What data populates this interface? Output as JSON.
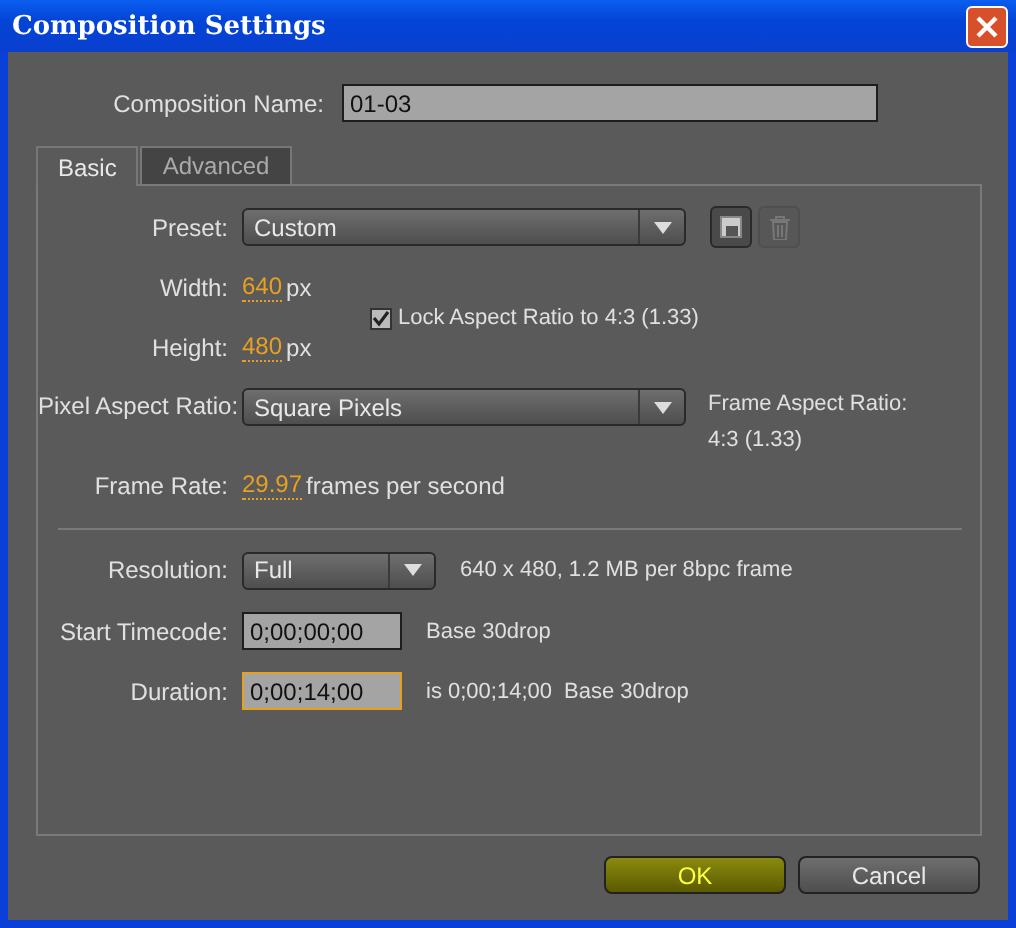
{
  "window": {
    "title": "Composition Settings"
  },
  "composition_name": {
    "label": "Composition Name:",
    "value": "01-03"
  },
  "tabs": [
    {
      "label": "Basic",
      "selected": true
    },
    {
      "label": "Advanced",
      "selected": false
    }
  ],
  "preset": {
    "label": "Preset:",
    "value": "Custom"
  },
  "width": {
    "label": "Width:",
    "value": "640",
    "unit": "px"
  },
  "lock_aspect": {
    "label": "Lock Aspect Ratio to 4:3 (1.33)",
    "checked": true
  },
  "height": {
    "label": "Height:",
    "value": "480",
    "unit": "px"
  },
  "pixel_aspect": {
    "label": "Pixel Aspect Ratio:",
    "value": "Square Pixels"
  },
  "frame_aspect": {
    "label": "Frame Aspect Ratio:",
    "value": "4:3 (1.33)"
  },
  "frame_rate": {
    "label": "Frame Rate:",
    "value": "29.97",
    "unit": "frames per second"
  },
  "resolution": {
    "label": "Resolution:",
    "value": "Full",
    "info": "640 x 480, 1.2 MB per 8bpc frame"
  },
  "start_timecode": {
    "label": "Start Timecode:",
    "value": "0;00;00;00",
    "focused": false,
    "info": "Base 30drop"
  },
  "duration": {
    "label": "Duration:",
    "value": "0;00;14;00",
    "focused": true,
    "info": "is 0;00;14;00",
    "base": "Base 30drop"
  },
  "buttons": [
    {
      "label": "OK",
      "default": true
    },
    {
      "label": "Cancel",
      "default": false
    }
  ]
}
